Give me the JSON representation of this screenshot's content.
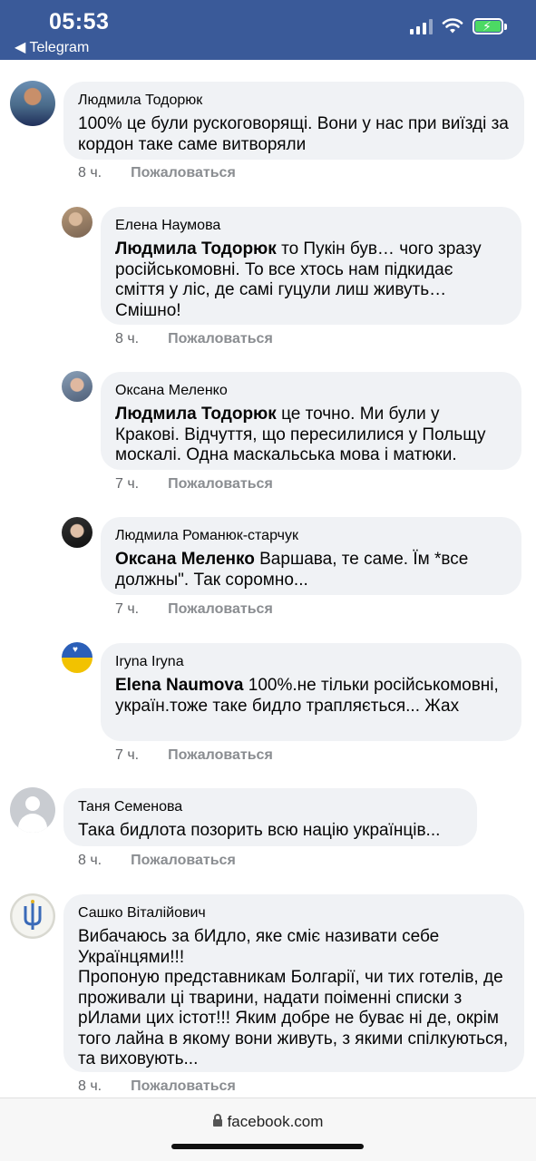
{
  "status_bar": {
    "time": "05:53",
    "back_label": "◀ Telegram",
    "icons": [
      "cellular-signal-icon",
      "wifi-icon",
      "battery-charging-icon"
    ],
    "battery_color": "#4cd964",
    "bar_color": "#3a5a99"
  },
  "comments": [
    {
      "author": "Людмила Тодорюк",
      "mention": "",
      "text": "100% це були рускоговорящі. Вони у нас при виїзді за кордон таке саме витворяли",
      "time": "8 ч.",
      "report": "Пожаловаться"
    },
    {
      "author": "Елена Наумова",
      "mention": "Людмила Тодорюк",
      "text": " то Пукін був… чого зразу російськомовні. То все хтось нам підкидає сміття у ліс, де самі гуцули лиш живуть… Смішно!",
      "time": "8 ч.",
      "report": "Пожаловаться"
    },
    {
      "author": "Оксана Меленко",
      "mention": "Людмила Тодорюк",
      "text": " це точно. Ми були у Кракові. Відчуття, що пересилилися у Польщу москалі. Одна маскальська мова і матюки.",
      "time": "7 ч.",
      "report": "Пожаловаться"
    },
    {
      "author": "Людмила Романюк-старчук",
      "mention": "Оксана Меленко",
      "text": " Варшава, те саме. Їм *все должны\". Так соромно...",
      "time": "7 ч.",
      "report": "Пожаловаться"
    },
    {
      "author": "Iryna Iryna",
      "mention": "Elena Naumova",
      "text": " 100%.не тільки російськомовні, україн.тоже таке бидло трапляється... Жах",
      "time": "7 ч.",
      "report": "Пожаловаться"
    },
    {
      "author": "Таня Семенова",
      "mention": "",
      "text": "Така бидлота позорить всю націю українців...",
      "time": "8 ч.",
      "report": "Пожаловаться"
    },
    {
      "author": "Сашко Віталійович",
      "mention": "",
      "text": "Вибачаюсь за бИдло, яке сміє називати себе Українцями!!!\nПропоную представникам Болгарії, чи тих готелів, де проживали ці тварини, надати поіменні списки з рИлами цих істот!!! Яким добре не буває ні де, окрім того лайна в якому вони живуть, з якими спілкуються, та виховують...",
      "time": "8 ч.",
      "report": "Пожаловаться"
    }
  ],
  "browser": {
    "url": "facebook.com"
  }
}
